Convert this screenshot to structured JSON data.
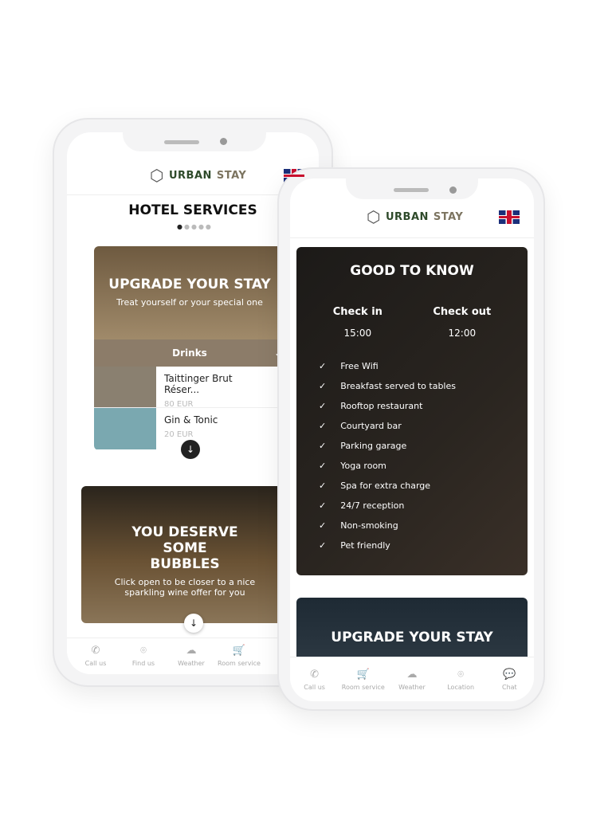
{
  "brand": {
    "name_a": "URBAN",
    "name_b": "STAY"
  },
  "back": {
    "title": "HOTEL SERVICES",
    "card1": {
      "title": "UPGRADE YOUR STAY",
      "subtitle": "Treat yourself or your special one",
      "category": "Drinks",
      "items": [
        {
          "name": "Taittinger Brut Réser...",
          "price": "80 EUR"
        },
        {
          "name": "Gin & Tonic",
          "price": "20 EUR"
        }
      ]
    },
    "card2": {
      "title": "YOU DESERVE SOME BUBBLES",
      "subtitle": "Click open to be closer to a nice sparkling wine offer for you"
    },
    "nav": [
      {
        "label": "Call us",
        "icon": "phone-icon"
      },
      {
        "label": "Find us",
        "icon": "location-icon"
      },
      {
        "label": "Weather",
        "icon": "cloud-icon"
      },
      {
        "label": "Room service",
        "icon": "cart-icon"
      }
    ]
  },
  "front": {
    "card1": {
      "title": "GOOD TO KNOW",
      "checkin_label": "Check in",
      "checkin": "15:00",
      "checkout_label": "Check out",
      "checkout": "12:00",
      "amenities": [
        "Free Wifi",
        "Breakfast served to tables",
        "Rooftop restaurant",
        "Courtyard bar",
        "Parking garage",
        "Yoga room",
        "Spa for extra charge",
        "24/7 reception",
        "Non-smoking",
        "Pet friendly"
      ]
    },
    "card2": {
      "title": "UPGRADE YOUR STAY"
    },
    "nav": [
      {
        "label": "Call us",
        "icon": "phone-icon"
      },
      {
        "label": "Room service",
        "icon": "cart-icon"
      },
      {
        "label": "Weather",
        "icon": "cloud-icon"
      },
      {
        "label": "Location",
        "icon": "location-icon"
      },
      {
        "label": "Chat",
        "icon": "chat-icon"
      }
    ]
  },
  "colors": {
    "drinks_bar": "#8c7c69",
    "logo_green": "#2e4a2a",
    "logo_tan": "#7c7460"
  }
}
